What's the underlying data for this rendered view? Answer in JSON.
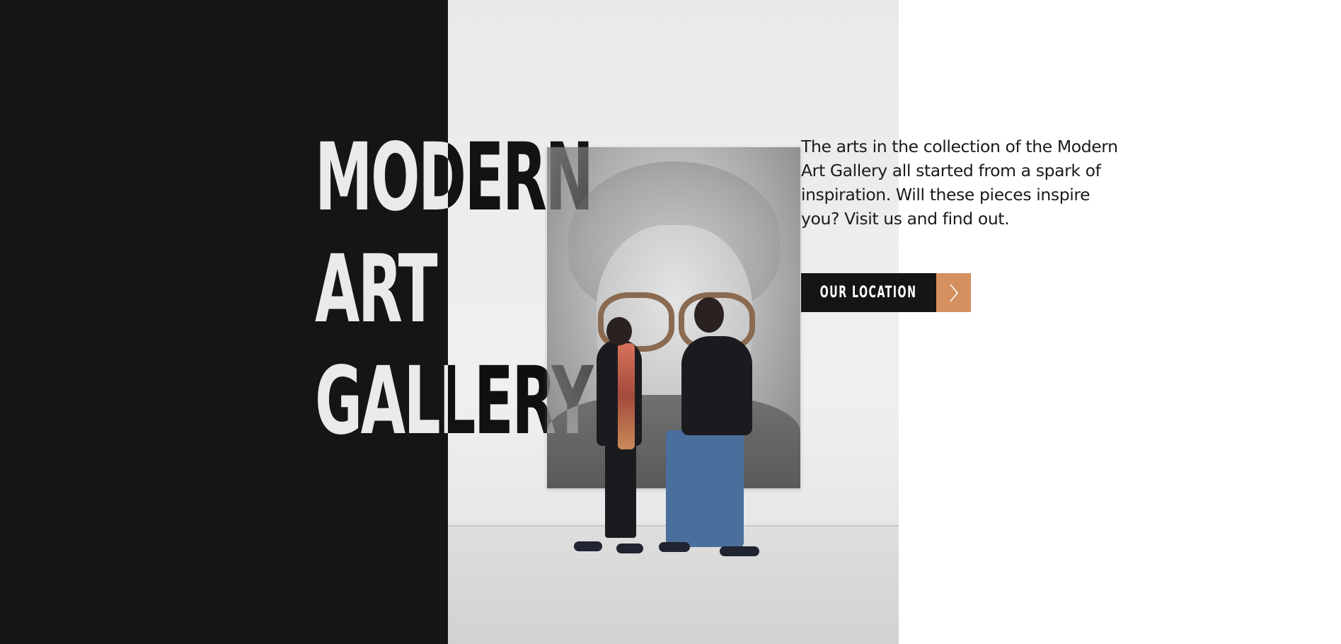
{
  "hero": {
    "title_lines": [
      "MODERN",
      "ART",
      "GALLERY"
    ],
    "description": "The arts in the collection of the Modern Art Gallery all started from a spark of inspiration. Will these pieces inspire you? Visit us and find out.",
    "cta_label": "OUR LOCATION",
    "cta_icon": "chevron-right-icon"
  },
  "colors": {
    "dark_panel": "#151515",
    "accent": "#d4905e",
    "text": "#1a1a1a",
    "background": "#ffffff"
  },
  "image": {
    "subject": "gallery-visitors-viewing-portrait-photo"
  }
}
